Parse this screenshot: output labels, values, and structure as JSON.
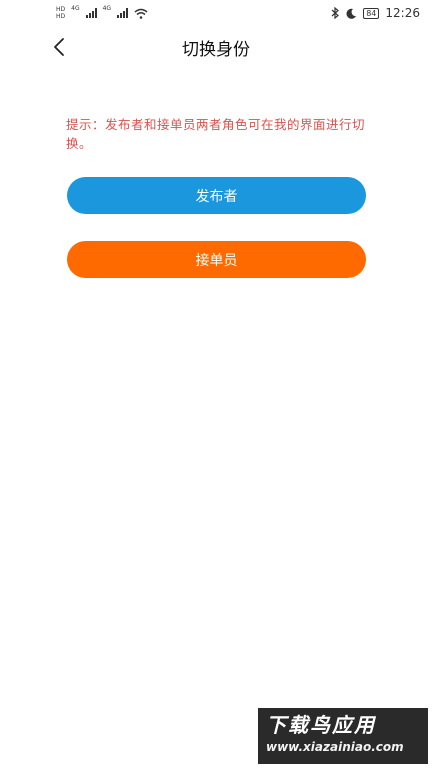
{
  "status_bar": {
    "hd_top": "HD",
    "hd_bottom": "HD",
    "net1": "4G",
    "net2": "4G",
    "battery": "84",
    "time": "12:26"
  },
  "nav": {
    "title": "切换身份"
  },
  "hint": {
    "text": "提示：发布者和接单员两者角色可在我的界面进行切换。"
  },
  "buttons": {
    "publisher_label": "发布者",
    "taker_label": "接单员"
  },
  "watermark": {
    "title": "下载鸟应用",
    "url": "www.xiazainiao.com"
  },
  "colors": {
    "publisher": "#1b97dd",
    "taker": "#ff6a00",
    "hint": "#d9534f"
  },
  "icons": [
    "bluetooth-icon",
    "moon-icon",
    "wifi-icon",
    "back-arrow-icon"
  ]
}
